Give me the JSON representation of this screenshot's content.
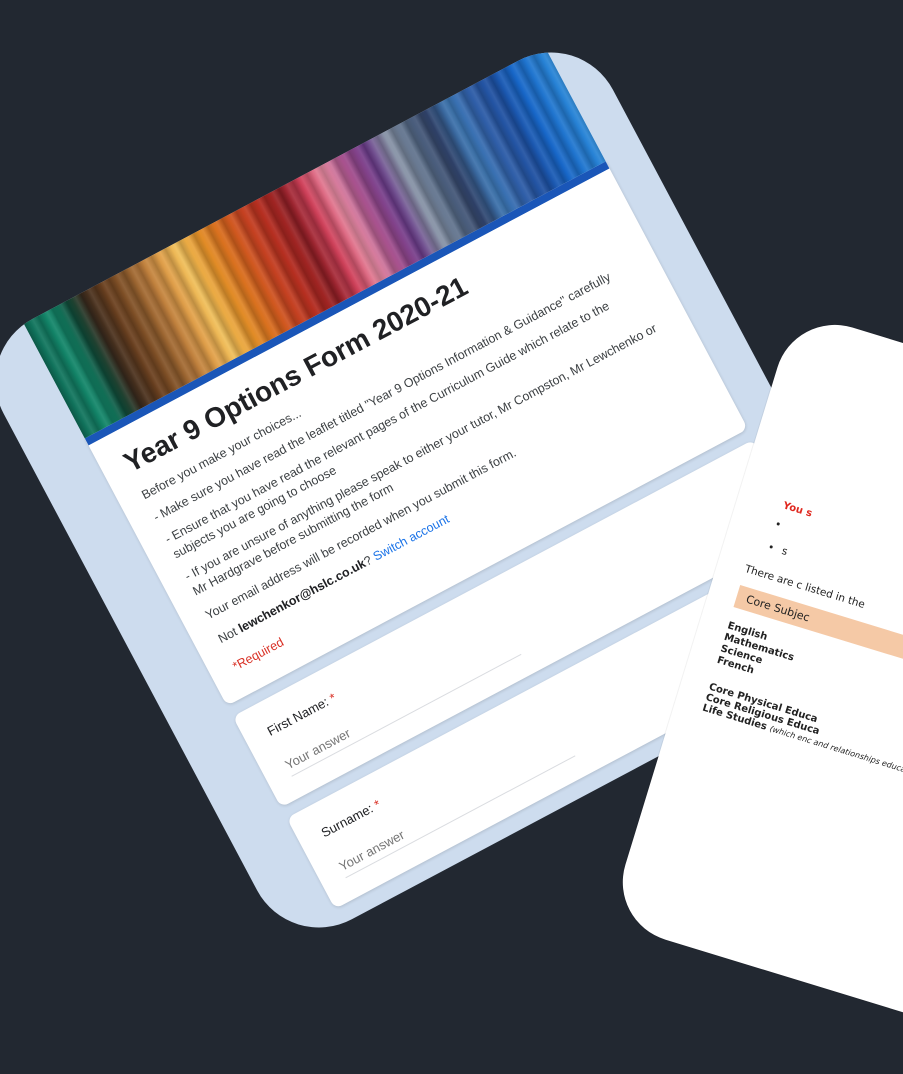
{
  "form": {
    "title": "Year 9 Options Form 2020-21",
    "description": [
      "Before you make your choices...",
      "- Make sure you have read the leaflet titled \"Year 9 Options Information & Guidance\" carefully",
      "- Ensure that you have read the relevant pages of the Curriculum Guide which relate to the subjects you are going to choose",
      "- If you are unsure of anything please speak to either your tutor, Mr Compston, Mr Lewchenko or Mr Hardgrave before submitting the form"
    ],
    "email_note": "Your email address will be recorded when you submit this form.",
    "not_prefix": "Not",
    "account_email": "lewchenkor@hslc.co.uk",
    "not_suffix": "?",
    "switch_account": "Switch account",
    "required_note": "*Required",
    "questions": [
      {
        "label": "First Name:",
        "required_mark": "*",
        "placeholder": "Your answer"
      },
      {
        "label": "Surname:",
        "required_mark": "*",
        "placeholder": "Your answer"
      }
    ]
  },
  "doc": {
    "must_label": "You s",
    "bullets": [
      "",
      "s"
    ],
    "intro": "There are c listed in the",
    "core_header": "Core Subjec",
    "subjects": [
      "English",
      "Mathematics",
      "Science",
      "French"
    ],
    "core_extra": [
      "Core Physical Educa",
      "Core Religious Educa",
      "Life Studies"
    ],
    "life_studies_note": "(which enc and relationships educatio"
  },
  "colors": {
    "background": "#222831",
    "panel": "#cddcee",
    "title_accent": "#1a56b8",
    "required": "#d93025",
    "link": "#1a73e8",
    "core_header_bg": "#f5c9a6"
  }
}
